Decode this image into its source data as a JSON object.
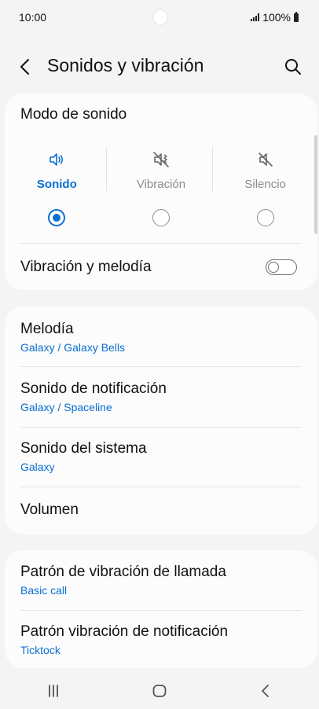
{
  "status_bar": {
    "time": "10:00",
    "battery_text": "100%"
  },
  "header": {
    "title": "Sonidos y vibración",
    "back_icon": "back-arrow-icon",
    "search_icon": "search-icon"
  },
  "sound_mode": {
    "label": "Modo de sonido",
    "options": [
      {
        "label": "Sonido",
        "icon": "speaker-icon",
        "selected": true
      },
      {
        "label": "Vibración",
        "icon": "vibrate-icon",
        "selected": false
      },
      {
        "label": "Silencio",
        "icon": "mute-icon",
        "selected": false
      }
    ],
    "vibrate_ring": {
      "label": "Vibración y melodía",
      "enabled": false
    }
  },
  "sounds": {
    "items": [
      {
        "title": "Melodía",
        "subtitle": "Galaxy / Galaxy Bells"
      },
      {
        "title": "Sonido de notificación",
        "subtitle": "Galaxy / Spaceline"
      },
      {
        "title": "Sonido del sistema",
        "subtitle": "Galaxy"
      },
      {
        "title": "Volumen"
      }
    ]
  },
  "vibration": {
    "items": [
      {
        "title": "Patrón de vibración de llamada",
        "subtitle": "Basic call"
      },
      {
        "title": "Patrón vibración de notificación",
        "subtitle": "Ticktock"
      }
    ]
  },
  "colors": {
    "accent": "#0a6fd1",
    "background": "#f4f4f4",
    "card": "#fcfcfc"
  },
  "nav": {
    "recents_icon": "recents-icon",
    "home_icon": "home-icon",
    "back_icon": "nav-back-icon"
  }
}
